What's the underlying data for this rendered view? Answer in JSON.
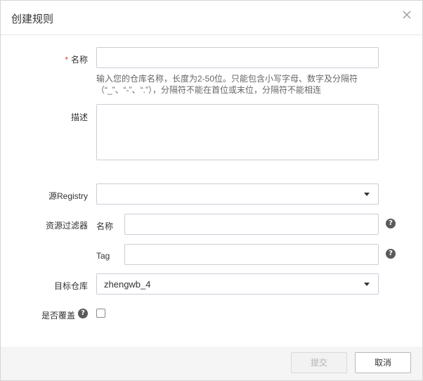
{
  "dialog": {
    "title": "创建规则"
  },
  "form": {
    "name": {
      "required_mark": "*",
      "label": "名称",
      "value": "",
      "hint_line1": "输入您的仓库名称，长度为2-50位。只能包含小写字母、数字及分隔符",
      "hint_line2": "（“_”、“-”、“.”），分隔符不能在首位或末位，分隔符不能相连"
    },
    "description": {
      "label": "描述",
      "value": ""
    },
    "source_registry": {
      "label": "源Registry",
      "selected": ""
    },
    "resource_filter": {
      "label": "资源过滤器",
      "name_label": "名称",
      "name_value": "",
      "tag_label": "Tag",
      "tag_value": "",
      "help_glyph": "?"
    },
    "target_repo": {
      "label": "目标仓库",
      "selected": "zhengwb_4"
    },
    "overwrite": {
      "label": "是否覆盖",
      "checked": false,
      "help_glyph": "?"
    }
  },
  "footer": {
    "submit_label": "提交",
    "cancel_label": "取消"
  },
  "icons": {
    "close": "close-icon",
    "help": "question-circle-icon",
    "dropdown": "caret-down-icon"
  },
  "colors": {
    "required": "#e03c3c",
    "border": "#c9ced6",
    "help_bg": "#5a5a5a",
    "footer_bg": "#f5f5f5",
    "disabled_text": "#b3b3b3"
  }
}
